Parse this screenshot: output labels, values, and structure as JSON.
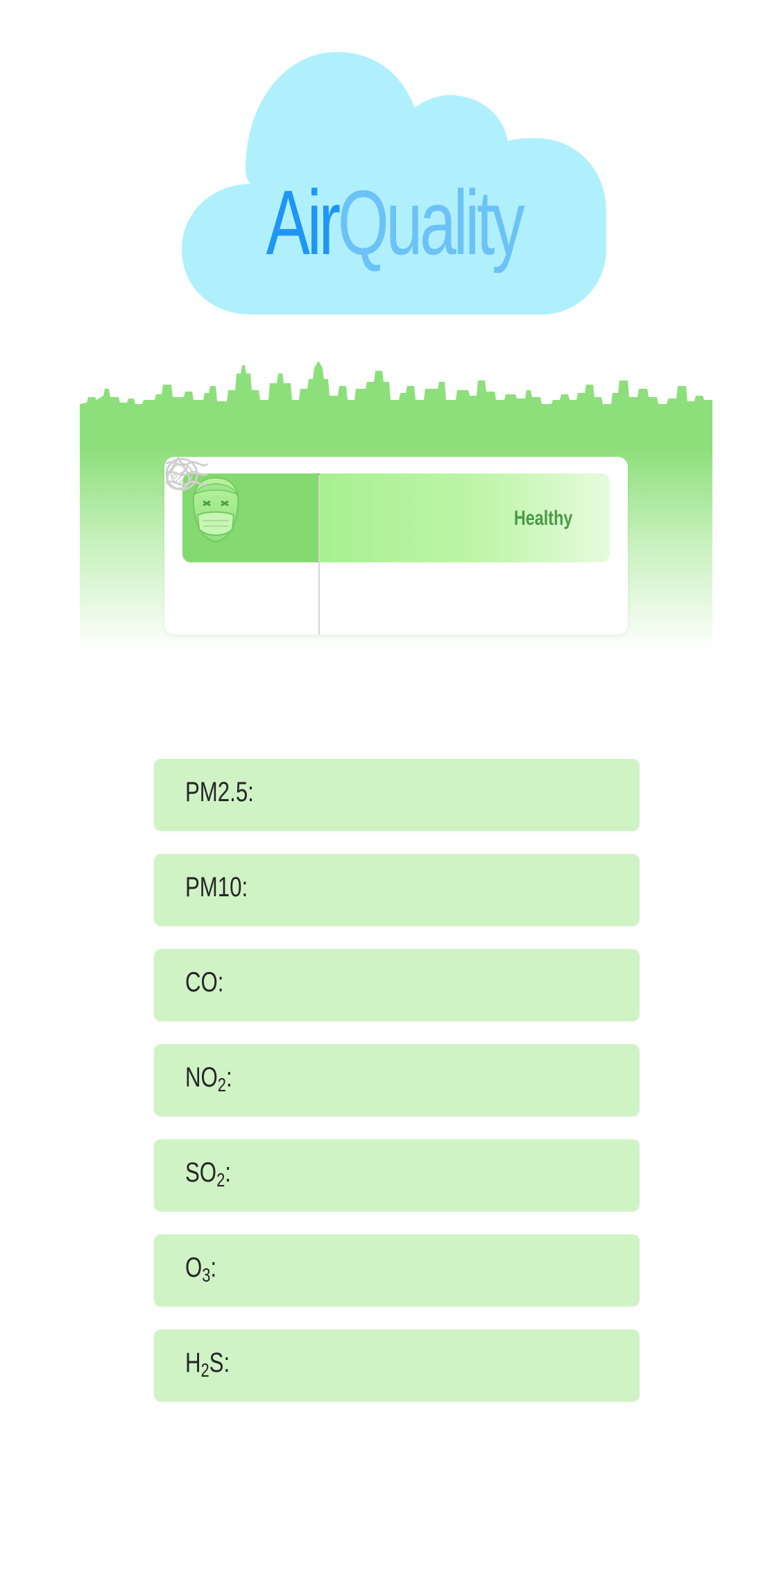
{
  "logo": {
    "air": "Air",
    "quality": "Quality"
  },
  "status": {
    "label": "Healthy",
    "face_icon": "masked-face-icon"
  },
  "metrics": {
    "wind_icon": "wind-icon",
    "pressure_icon": "gauge-icon",
    "humidity_icon": "humidity-drop-icon"
  },
  "pollutants": [
    {
      "label": "PM2.5:",
      "value": ""
    },
    {
      "label": "PM10:",
      "value": ""
    },
    {
      "label": "CO:",
      "value": ""
    },
    {
      "label": "NO2:",
      "value": ""
    },
    {
      "label": "SO2:",
      "value": ""
    },
    {
      "label": "O3:",
      "value": ""
    },
    {
      "label": "H2S:",
      "value": ""
    }
  ],
  "colors": {
    "air_text": "#1e96f5",
    "quality_text": "#6cc2f7",
    "cloud": "#b0f0fd",
    "skyline": "#8ddf7b",
    "status_bar": "#a5f08f",
    "row_background": "#d0f3c6"
  }
}
